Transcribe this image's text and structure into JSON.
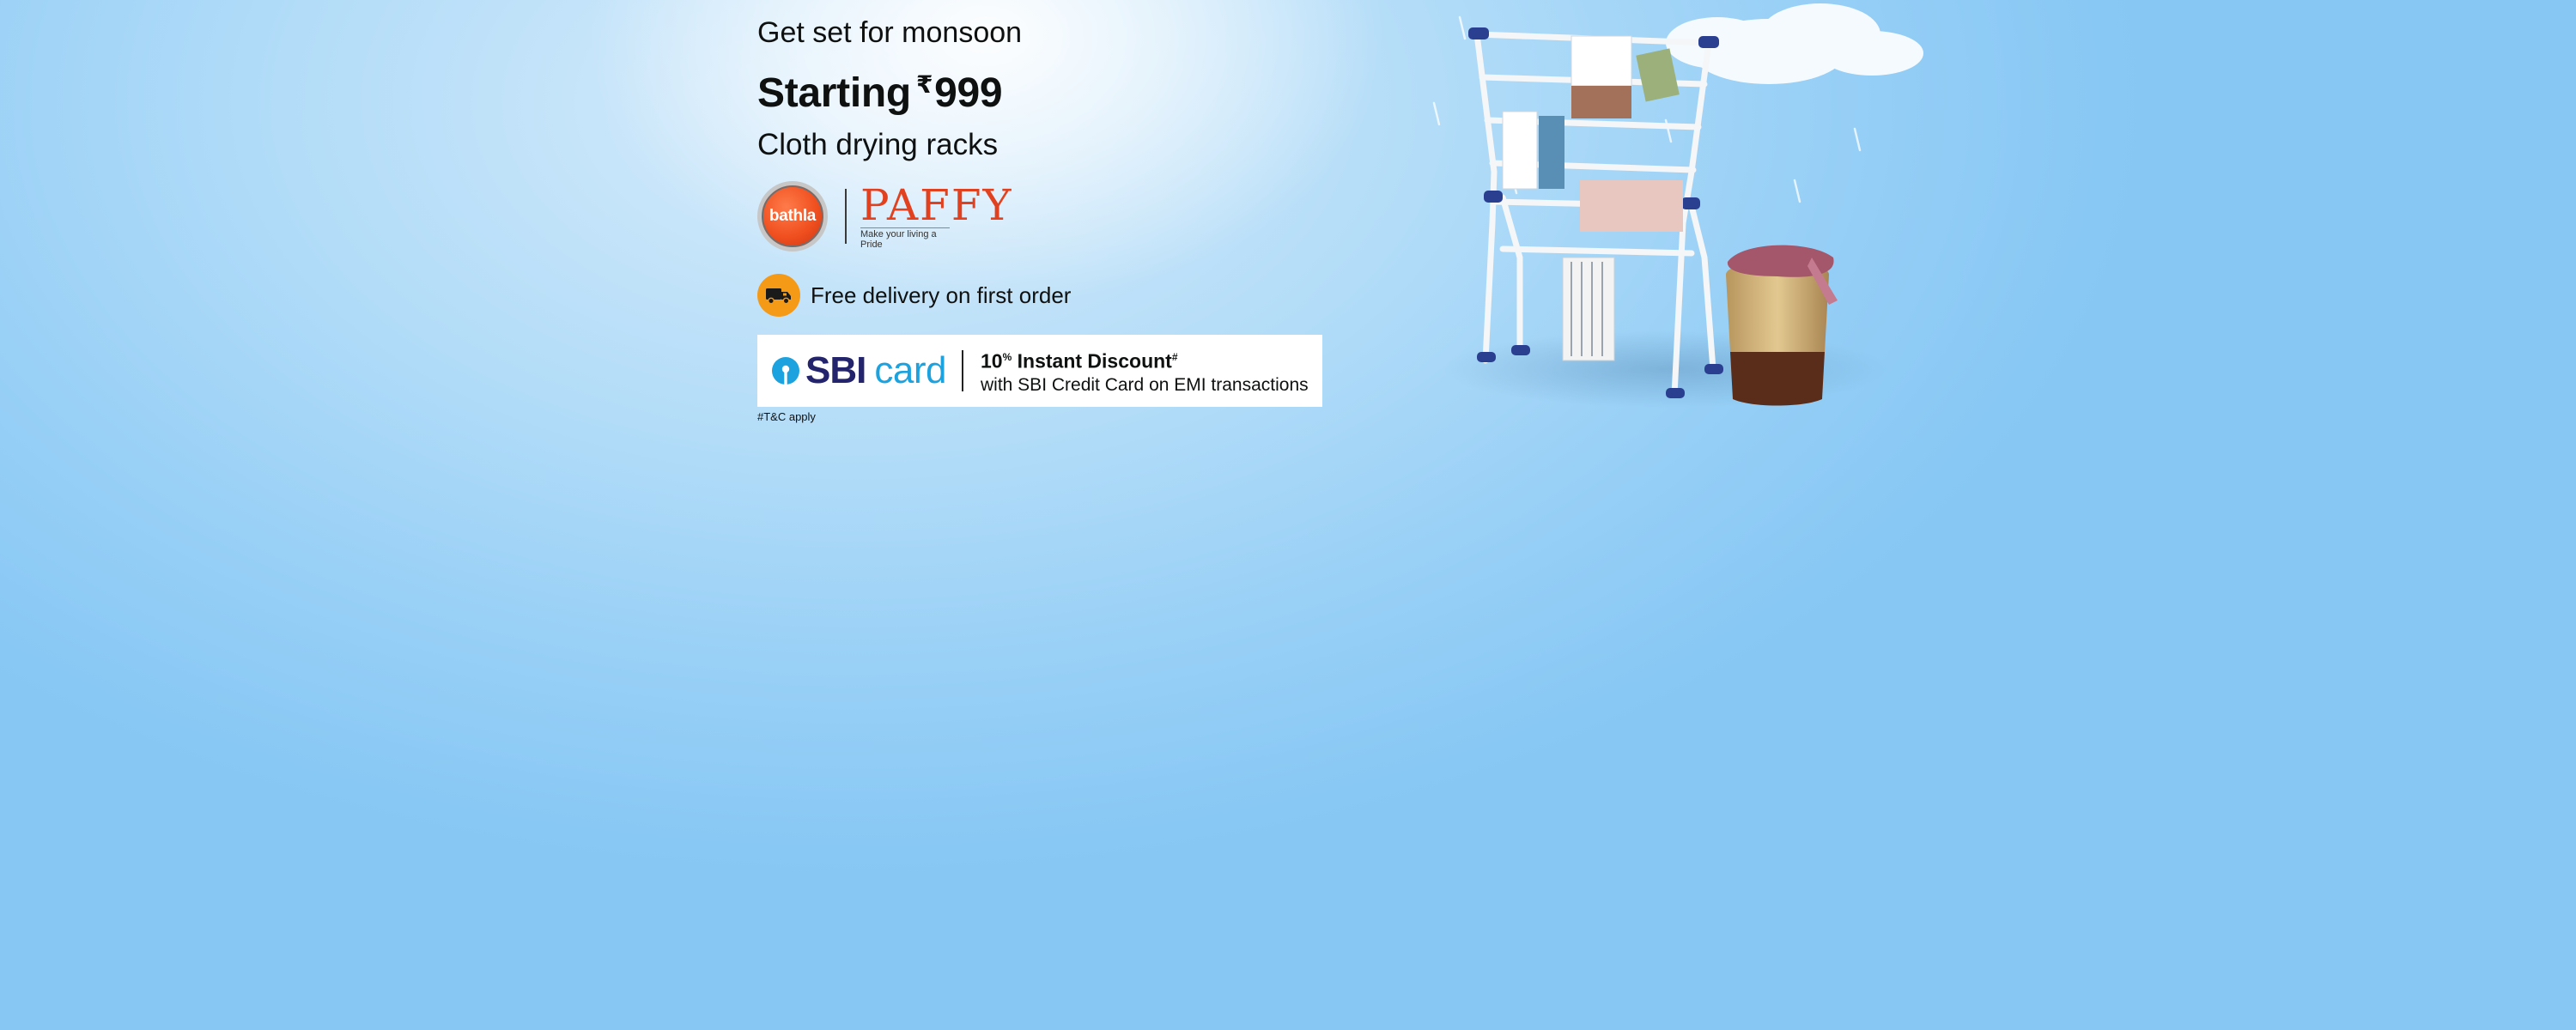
{
  "banner": {
    "kicker": "Get set for monsoon",
    "headline_prefix": "Starting",
    "currency_symbol": "₹",
    "price": "999",
    "subhead": "Cloth drying racks",
    "brands": {
      "bathla": "bathla",
      "paffy": "PAFFY",
      "paffy_tagline": "Make your living a Pride"
    },
    "delivery_text": "Free delivery on first order",
    "offer": {
      "bank_sbi": "SBI",
      "bank_card": "card",
      "discount_percent": "10",
      "discount_percent_sign": "%",
      "discount_label": "Instant Discount",
      "discount_mark": "#",
      "discount_subtext": "with SBI Credit Card on EMI transactions"
    },
    "tnc": "#T&C apply"
  },
  "icons": {
    "truck": "truck-icon",
    "sbi": "sbi-keyhole-icon"
  },
  "colors": {
    "background": "#9fd3f7",
    "delivery_badge": "#f59a16",
    "sbi_blue": "#23246b",
    "card_blue": "#1ca3df",
    "bathla_orange": "#f04f1f",
    "paffy_red": "#e2411f"
  }
}
